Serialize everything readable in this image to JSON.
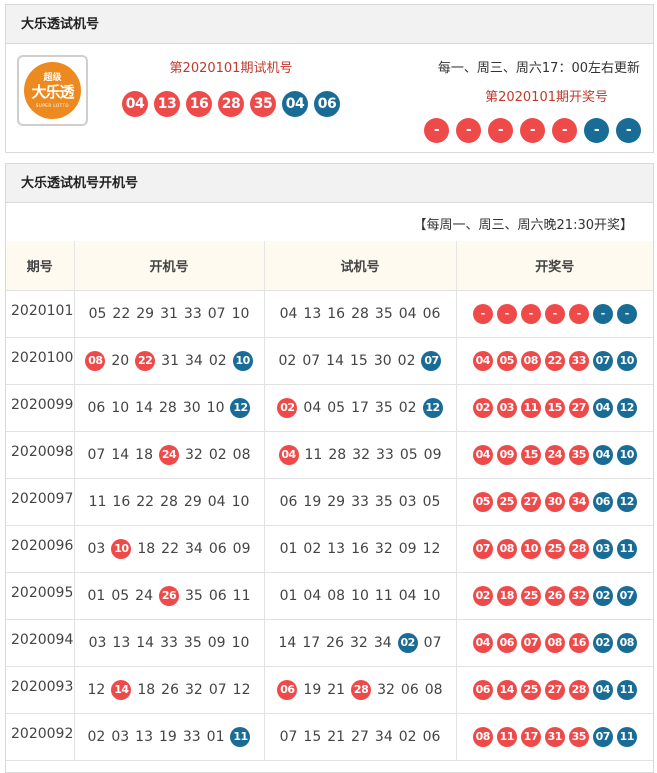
{
  "top_panel": {
    "title": "大乐透试机号",
    "logo": {
      "sup": "超级",
      "main": "大乐透",
      "sub": "SUPER LOTTO"
    },
    "trial_title": "第2020101期试机号",
    "trial_numbers": [
      {
        "n": "04",
        "c": "red"
      },
      {
        "n": "13",
        "c": "red"
      },
      {
        "n": "16",
        "c": "red"
      },
      {
        "n": "28",
        "c": "red"
      },
      {
        "n": "35",
        "c": "red"
      },
      {
        "n": "04",
        "c": "blue"
      },
      {
        "n": "06",
        "c": "blue"
      }
    ],
    "update_note": "每一、周三、周六17：00左右更新",
    "draw_title": "第2020101期开奖号",
    "draw_numbers": [
      {
        "n": "-",
        "c": "red"
      },
      {
        "n": "-",
        "c": "red"
      },
      {
        "n": "-",
        "c": "red"
      },
      {
        "n": "-",
        "c": "red"
      },
      {
        "n": "-",
        "c": "red"
      },
      {
        "n": "-",
        "c": "blue"
      },
      {
        "n": "-",
        "c": "blue"
      }
    ]
  },
  "bottom_panel": {
    "title": "大乐透试机号开机号",
    "schedule": "【每周一、周三、周六晚21:30开奖】",
    "headers": [
      "期号",
      "开机号",
      "试机号",
      "开奖号"
    ],
    "colors": {
      "red": "#ee4a4a",
      "blue": "#196c96"
    },
    "rows": [
      {
        "period": "2020101",
        "open": [
          {
            "n": "05"
          },
          {
            "n": "22"
          },
          {
            "n": "29"
          },
          {
            "n": "31"
          },
          {
            "n": "33"
          },
          {
            "n": "07"
          },
          {
            "n": "10"
          }
        ],
        "trial": [
          {
            "n": "04"
          },
          {
            "n": "13"
          },
          {
            "n": "16"
          },
          {
            "n": "28"
          },
          {
            "n": "35"
          },
          {
            "n": "04"
          },
          {
            "n": "06"
          }
        ],
        "result": [
          "-",
          "-",
          "-",
          "-",
          "-",
          "-",
          "-"
        ]
      },
      {
        "period": "2020100",
        "open": [
          {
            "n": "08",
            "hl": "red"
          },
          {
            "n": "20"
          },
          {
            "n": "22",
            "hl": "red"
          },
          {
            "n": "31"
          },
          {
            "n": "34"
          },
          {
            "n": "02"
          },
          {
            "n": "10",
            "hl": "blue"
          }
        ],
        "trial": [
          {
            "n": "02"
          },
          {
            "n": "07"
          },
          {
            "n": "14"
          },
          {
            "n": "15"
          },
          {
            "n": "30"
          },
          {
            "n": "02"
          },
          {
            "n": "07",
            "hl": "blue"
          }
        ],
        "result": [
          "04",
          "05",
          "08",
          "22",
          "33",
          "07",
          "10"
        ]
      },
      {
        "period": "2020099",
        "open": [
          {
            "n": "06"
          },
          {
            "n": "10"
          },
          {
            "n": "14"
          },
          {
            "n": "28"
          },
          {
            "n": "30"
          },
          {
            "n": "10"
          },
          {
            "n": "12",
            "hl": "blue"
          }
        ],
        "trial": [
          {
            "n": "02",
            "hl": "red"
          },
          {
            "n": "04"
          },
          {
            "n": "05"
          },
          {
            "n": "17"
          },
          {
            "n": "35"
          },
          {
            "n": "02"
          },
          {
            "n": "12",
            "hl": "blue"
          }
        ],
        "result": [
          "02",
          "03",
          "11",
          "15",
          "27",
          "04",
          "12"
        ]
      },
      {
        "period": "2020098",
        "open": [
          {
            "n": "07"
          },
          {
            "n": "14"
          },
          {
            "n": "18"
          },
          {
            "n": "24",
            "hl": "red"
          },
          {
            "n": "32"
          },
          {
            "n": "02"
          },
          {
            "n": "08"
          }
        ],
        "trial": [
          {
            "n": "04",
            "hl": "red"
          },
          {
            "n": "11"
          },
          {
            "n": "28"
          },
          {
            "n": "32"
          },
          {
            "n": "33"
          },
          {
            "n": "05"
          },
          {
            "n": "09"
          }
        ],
        "result": [
          "04",
          "09",
          "15",
          "24",
          "35",
          "04",
          "10"
        ]
      },
      {
        "period": "2020097",
        "open": [
          {
            "n": "11"
          },
          {
            "n": "16"
          },
          {
            "n": "22"
          },
          {
            "n": "28"
          },
          {
            "n": "29"
          },
          {
            "n": "04"
          },
          {
            "n": "10"
          }
        ],
        "trial": [
          {
            "n": "06"
          },
          {
            "n": "19"
          },
          {
            "n": "29"
          },
          {
            "n": "33"
          },
          {
            "n": "35"
          },
          {
            "n": "03"
          },
          {
            "n": "05"
          }
        ],
        "result": [
          "05",
          "25",
          "27",
          "30",
          "34",
          "06",
          "12"
        ]
      },
      {
        "period": "2020096",
        "open": [
          {
            "n": "03"
          },
          {
            "n": "10",
            "hl": "red"
          },
          {
            "n": "18"
          },
          {
            "n": "22"
          },
          {
            "n": "34"
          },
          {
            "n": "06"
          },
          {
            "n": "09"
          }
        ],
        "trial": [
          {
            "n": "01"
          },
          {
            "n": "02"
          },
          {
            "n": "13"
          },
          {
            "n": "16"
          },
          {
            "n": "32"
          },
          {
            "n": "09"
          },
          {
            "n": "12"
          }
        ],
        "result": [
          "07",
          "08",
          "10",
          "25",
          "28",
          "03",
          "11"
        ]
      },
      {
        "period": "2020095",
        "open": [
          {
            "n": "01"
          },
          {
            "n": "05"
          },
          {
            "n": "24"
          },
          {
            "n": "26",
            "hl": "red"
          },
          {
            "n": "35"
          },
          {
            "n": "06"
          },
          {
            "n": "11"
          }
        ],
        "trial": [
          {
            "n": "01"
          },
          {
            "n": "04"
          },
          {
            "n": "08"
          },
          {
            "n": "10"
          },
          {
            "n": "11"
          },
          {
            "n": "04"
          },
          {
            "n": "10"
          }
        ],
        "result": [
          "02",
          "18",
          "25",
          "26",
          "32",
          "02",
          "07"
        ]
      },
      {
        "period": "2020094",
        "open": [
          {
            "n": "03"
          },
          {
            "n": "13"
          },
          {
            "n": "14"
          },
          {
            "n": "33"
          },
          {
            "n": "35"
          },
          {
            "n": "09"
          },
          {
            "n": "10"
          }
        ],
        "trial": [
          {
            "n": "14"
          },
          {
            "n": "17"
          },
          {
            "n": "26"
          },
          {
            "n": "32"
          },
          {
            "n": "34"
          },
          {
            "n": "02",
            "hl": "blue"
          },
          {
            "n": "07"
          }
        ],
        "result": [
          "04",
          "06",
          "07",
          "08",
          "16",
          "02",
          "08"
        ]
      },
      {
        "period": "2020093",
        "open": [
          {
            "n": "12"
          },
          {
            "n": "14",
            "hl": "red"
          },
          {
            "n": "18"
          },
          {
            "n": "26"
          },
          {
            "n": "32"
          },
          {
            "n": "07"
          },
          {
            "n": "12"
          }
        ],
        "trial": [
          {
            "n": "06",
            "hl": "red"
          },
          {
            "n": "19"
          },
          {
            "n": "21"
          },
          {
            "n": "28",
            "hl": "red"
          },
          {
            "n": "32"
          },
          {
            "n": "06"
          },
          {
            "n": "08"
          }
        ],
        "result": [
          "06",
          "14",
          "25",
          "27",
          "28",
          "04",
          "11"
        ]
      },
      {
        "period": "2020092",
        "open": [
          {
            "n": "02"
          },
          {
            "n": "03"
          },
          {
            "n": "13"
          },
          {
            "n": "19"
          },
          {
            "n": "33"
          },
          {
            "n": "01"
          },
          {
            "n": "11",
            "hl": "blue"
          }
        ],
        "trial": [
          {
            "n": "07"
          },
          {
            "n": "15"
          },
          {
            "n": "21"
          },
          {
            "n": "27"
          },
          {
            "n": "34"
          },
          {
            "n": "02"
          },
          {
            "n": "06"
          }
        ],
        "result": [
          "08",
          "11",
          "17",
          "31",
          "35",
          "07",
          "11"
        ]
      }
    ]
  }
}
